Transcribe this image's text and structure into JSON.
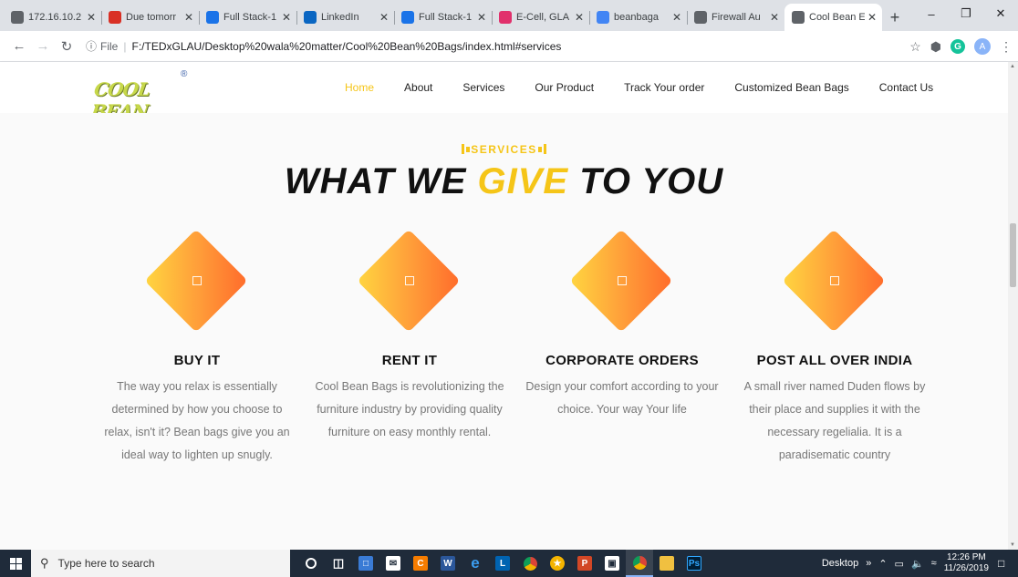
{
  "browser": {
    "tabs": [
      {
        "title": "172.16.10.2",
        "icon": "globe-icon",
        "color": "#5f6368"
      },
      {
        "title": "Due tomorr",
        "icon": "gmail-icon",
        "color": "#d93025"
      },
      {
        "title": "Full Stack-1",
        "icon": "classroom-icon",
        "color": "#1a73e8"
      },
      {
        "title": "LinkedIn",
        "icon": "linkedin-icon",
        "color": "#0a66c2"
      },
      {
        "title": "Full Stack-1",
        "icon": "classroom-icon",
        "color": "#1a73e8"
      },
      {
        "title": "E-Cell, GLA",
        "icon": "instagram-icon",
        "color": "#e1306c"
      },
      {
        "title": "beanbaga",
        "icon": "google-icon",
        "color": "#4285f4"
      },
      {
        "title": "Firewall Au",
        "icon": "globe-icon",
        "color": "#5f6368"
      },
      {
        "title": "Cool Bean E",
        "icon": "globe-icon",
        "color": "#5f6368",
        "active": true
      }
    ],
    "address": {
      "scheme": "File",
      "url": "F:/TEDxGLAU/Desktop%20wala%20matter/Cool%20Bean%20Bags/index.html#services"
    }
  },
  "site": {
    "logo_text": "COOL BEAN BAGS",
    "nav": [
      "Home",
      "About",
      "Services",
      "Our Product",
      "Track Your order",
      "Customized Bean Bags",
      "Contact Us"
    ],
    "active_nav": "Home",
    "accent": "#f5c518"
  },
  "services": {
    "subheading": "SERVICES",
    "heading_pre": "WHAT WE ",
    "heading_highlight": "GIVE",
    "heading_post": " TO YOU",
    "cards": [
      {
        "title": "BUY IT",
        "text": "The way you relax is essentially determined by how you choose to relax, isn't it? Bean bags give you an ideal way to lighten up snugly."
      },
      {
        "title": "RENT IT",
        "text": "Cool Bean Bags is revolutionizing the furniture industry by providing quality furniture on easy monthly rental."
      },
      {
        "title": "CORPORATE ORDERS",
        "text": "Design your comfort according to your choice. Your way Your life"
      },
      {
        "title": "POST ALL OVER INDIA",
        "text": "A small river named Duden flows by their place and supplies it with the necessary regelialia. It is a paradisematic country"
      }
    ]
  },
  "taskbar": {
    "search_placeholder": "Type here to search",
    "desktop_label": "Desktop",
    "time": "12:26 PM",
    "date": "11/26/2019"
  }
}
